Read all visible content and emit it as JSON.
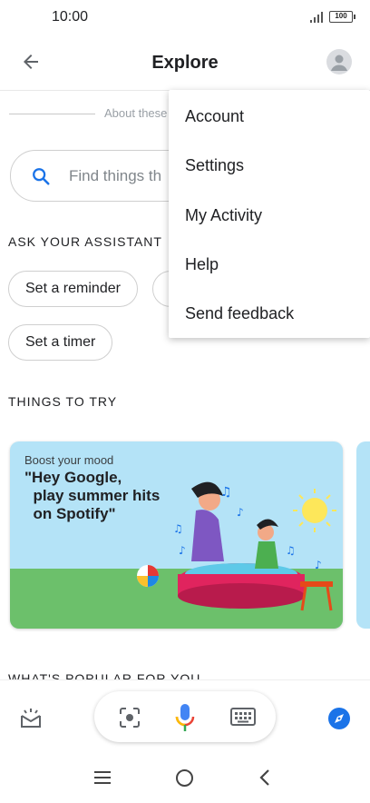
{
  "status_bar": {
    "time": "10:00",
    "battery": "100"
  },
  "app_bar": {
    "title": "Explore"
  },
  "about": {
    "text": "About these"
  },
  "search": {
    "placeholder": "Find things th"
  },
  "assistant": {
    "heading": "ASK YOUR ASSISTANT",
    "chips": [
      "Set a reminder",
      "Set a timer"
    ]
  },
  "things_to_try": {
    "heading": "THINGS TO TRY",
    "card": {
      "subtitle": "Boost your mood",
      "quote": "\"Hey Google,\n  play summer hits\n  on Spotify\""
    }
  },
  "popular": {
    "heading": "WHAT'S POPULAR FOR YOU"
  },
  "menu": {
    "items": [
      "Account",
      "Settings",
      "My Activity",
      "Help",
      "Send feedback"
    ]
  },
  "colors": {
    "accent": "#1a73e8",
    "card_bg": "#b4e3f7",
    "grass": "#6cc06b",
    "pool": "#e0245e"
  },
  "icons": {
    "back": "arrow-left-icon",
    "avatar": "account-circle-icon",
    "search": "search-icon",
    "snapshot": "snapshot-icon",
    "lens": "lens-icon",
    "mic": "mic-icon",
    "keyboard": "keyboard-icon",
    "explore": "compass-icon"
  }
}
